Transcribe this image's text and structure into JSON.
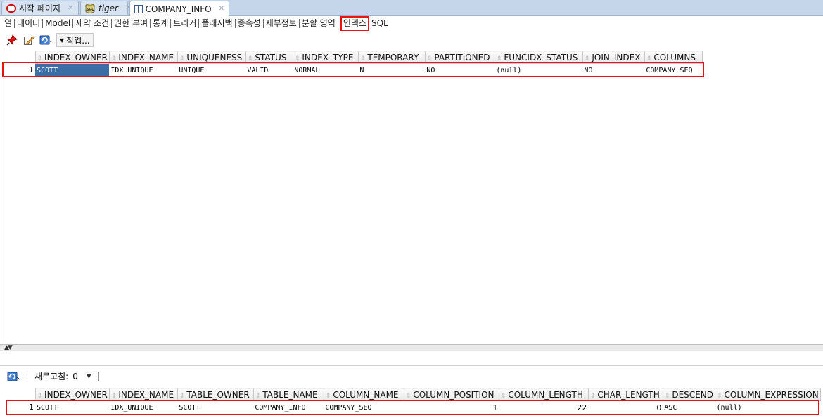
{
  "editor_tabs": [
    {
      "label": "시작 페이지",
      "icon": "oracle-start-icon"
    },
    {
      "label": "tiger",
      "icon": "sql-worksheet-icon"
    },
    {
      "label": "COMPANY_INFO",
      "icon": "table-grid-icon"
    }
  ],
  "sub_tabs": [
    "열",
    "데이터",
    "Model",
    "제약 조건",
    "권한 부여",
    "통계",
    "트리거",
    "플래시백",
    "종속성",
    "세부정보",
    "분할 영역",
    "인덱스",
    "SQL"
  ],
  "selected_sub_tab": "인덱스",
  "toolbar": {
    "actions_label": "작업..."
  },
  "index_grid": {
    "columns": [
      "INDEX_OWNER",
      "INDEX_NAME",
      "UNIQUENESS",
      "STATUS",
      "INDEX_TYPE",
      "TEMPORARY",
      "PARTITIONED",
      "FUNCIDX_STATUS",
      "JOIN_INDEX",
      "COLUMNS"
    ],
    "rows": [
      {
        "num": "1",
        "cells": [
          "SCOTT",
          "IDX_UNIQUE",
          "UNIQUE",
          "VALID",
          "NORMAL",
          "N",
          "NO",
          "(null)",
          "NO",
          "COMPANY_SEQ"
        ]
      }
    ]
  },
  "bottom": {
    "refresh_label": "새로고침:",
    "refresh_value": "0"
  },
  "column_grid": {
    "columns": [
      "INDEX_OWNER",
      "INDEX_NAME",
      "TABLE_OWNER",
      "TABLE_NAME",
      "COLUMN_NAME",
      "COLUMN_POSITION",
      "COLUMN_LENGTH",
      "CHAR_LENGTH",
      "DESCEND",
      "COLUMN_EXPRESSION"
    ],
    "rows": [
      {
        "num": "1",
        "cells": [
          "SCOTT",
          "IDX_UNIQUE",
          "SCOTT",
          "COMPANY_INFO",
          "COMPANY_SEQ",
          "1",
          "22",
          "0",
          "ASC",
          "(null)"
        ]
      }
    ]
  },
  "colors": {
    "highlight": "#ee1111",
    "selection": "#3b6ea5",
    "tabbar": "#c6d6ea"
  }
}
